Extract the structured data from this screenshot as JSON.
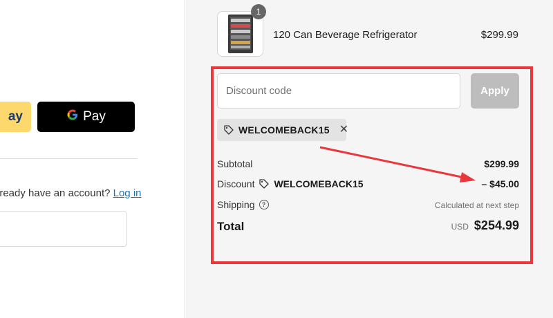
{
  "left": {
    "paypal_label": "ay",
    "gpay_label": "Pay",
    "account_prompt": "lready have an account?",
    "login_link": "Log in"
  },
  "cart": {
    "quantity": "1",
    "product_name": "120 Can Beverage Refrigerator",
    "product_price": "$299.99"
  },
  "discount": {
    "placeholder": "Discount code",
    "apply_label": "Apply",
    "applied_code": "WELCOMEBACK15"
  },
  "summary": {
    "subtotal_label": "Subtotal",
    "subtotal_value": "$299.99",
    "discount_label": "Discount",
    "discount_code": "WELCOMEBACK15",
    "discount_value": "– $45.00",
    "shipping_label": "Shipping",
    "shipping_value": "Calculated at next step",
    "total_label": "Total",
    "currency": "USD",
    "total_value": "$254.99"
  },
  "icons": {
    "tag": "tag-icon",
    "close": "close-icon",
    "info": "info-icon",
    "google": "google-g-icon"
  },
  "colors": {
    "annotation_red": "#e8383d",
    "link_blue": "#1773b0",
    "paypal_yellow": "#fdd96d",
    "apply_disabled": "#bdbdbd"
  }
}
